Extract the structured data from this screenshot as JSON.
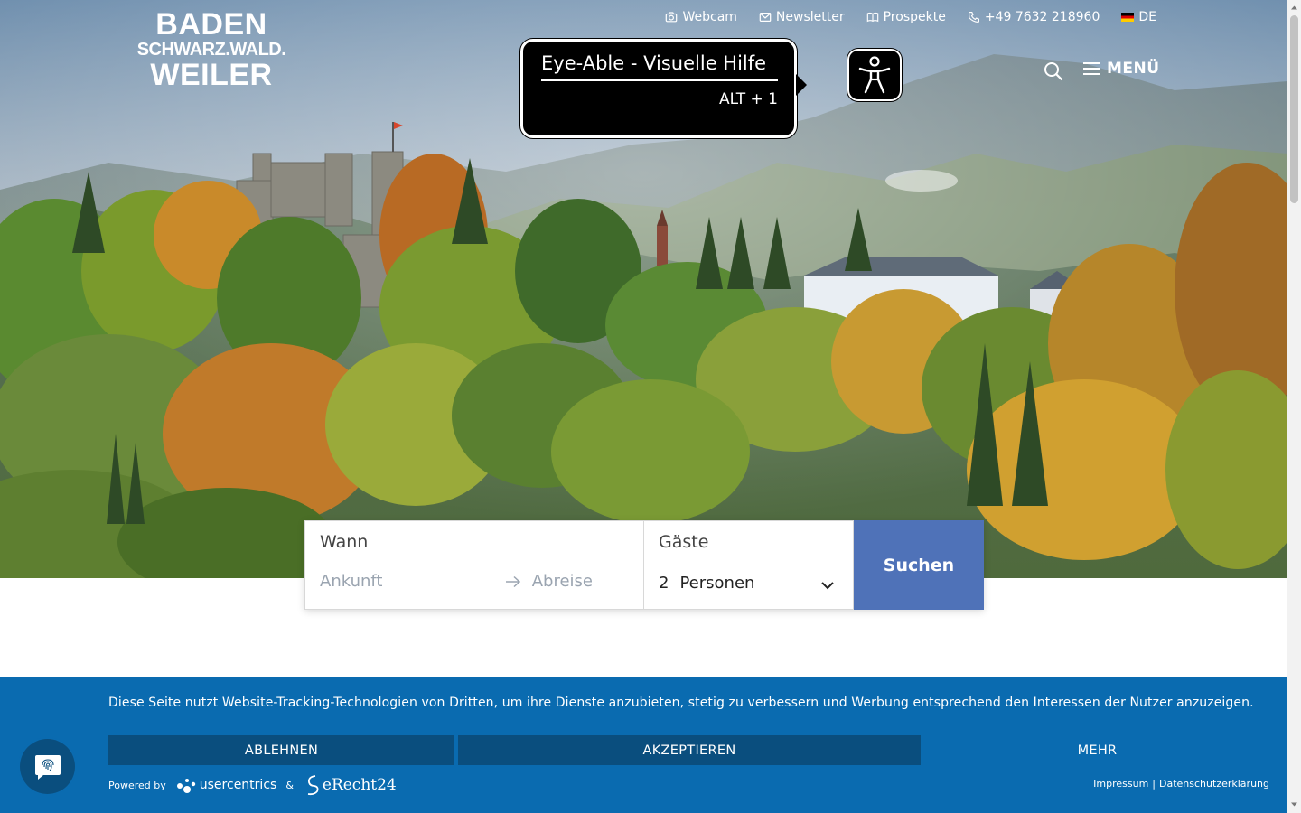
{
  "logo": {
    "line1": "BADEN",
    "line2": "SCHWARZ.WALD.",
    "line3": "WEILER"
  },
  "topnav": [
    {
      "label": "Webcam",
      "icon": "camera-icon"
    },
    {
      "label": "Newsletter",
      "icon": "envelope-icon"
    },
    {
      "label": "Prospekte",
      "icon": "book-icon"
    },
    {
      "label": "+49 7632 218960",
      "icon": "phone-icon"
    },
    {
      "label": "DE",
      "icon": "german-flag-icon"
    }
  ],
  "menu": {
    "label": "MENÜ"
  },
  "accessibility": {
    "title": "Eye-Able - Visuelle Hilfe",
    "shortcut": "ALT + 1"
  },
  "booking": {
    "when_label": "Wann",
    "arrival_placeholder": "Ankunft",
    "departure_placeholder": "Abreise",
    "guests_label": "Gäste",
    "guests_count": "2",
    "guests_unit": "Personen",
    "submit_label": "Suchen"
  },
  "cookie": {
    "message": "Diese Seite nutzt Website-Tracking-Technologien von Dritten, um ihre Dienste anzubieten, stetig zu verbessern und Werbung entsprechend den Interessen der Nutzer anzuzeigen.",
    "decline": "ABLEHNEN",
    "accept": "AKZEPTIEREN",
    "more": "MEHR",
    "powered_by": "Powered by",
    "provider1": "usercentrics",
    "amp": "&",
    "provider2": "eRecht24",
    "impressum": "Impressum",
    "separator": "|",
    "privacy": "Datenschutzerklärung"
  },
  "colors": {
    "brand_blue": "#0a6bb0",
    "button_dark": "#0a4e7e",
    "search_button": "#4f72b8"
  }
}
